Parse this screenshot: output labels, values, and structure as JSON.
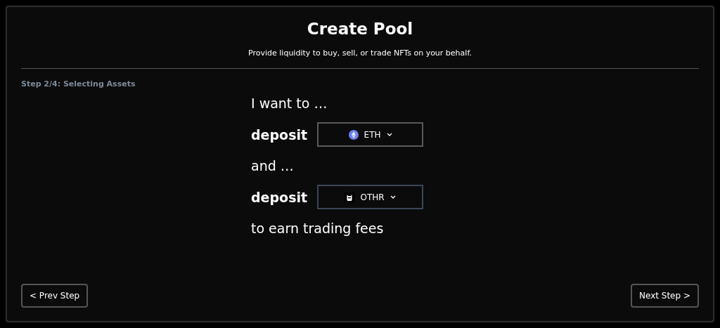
{
  "title": "Create Pool",
  "subtitle": "Provide liquidity to buy, sell, or trade NFTs on your behalf.",
  "step": "Step 2/4: Selecting Assets",
  "lines": [
    {
      "kind": "text",
      "text": "I want to …"
    },
    {
      "kind": "select",
      "label": "deposit",
      "token": "ETH",
      "focused": false
    },
    {
      "kind": "text",
      "text": "and …"
    },
    {
      "kind": "select",
      "label": "deposit",
      "token": "OTHR",
      "focused": true
    },
    {
      "kind": "text",
      "text": "to earn trading fees"
    }
  ],
  "buttons": {
    "prev": "< Prev Step",
    "next": "Next Step >"
  }
}
